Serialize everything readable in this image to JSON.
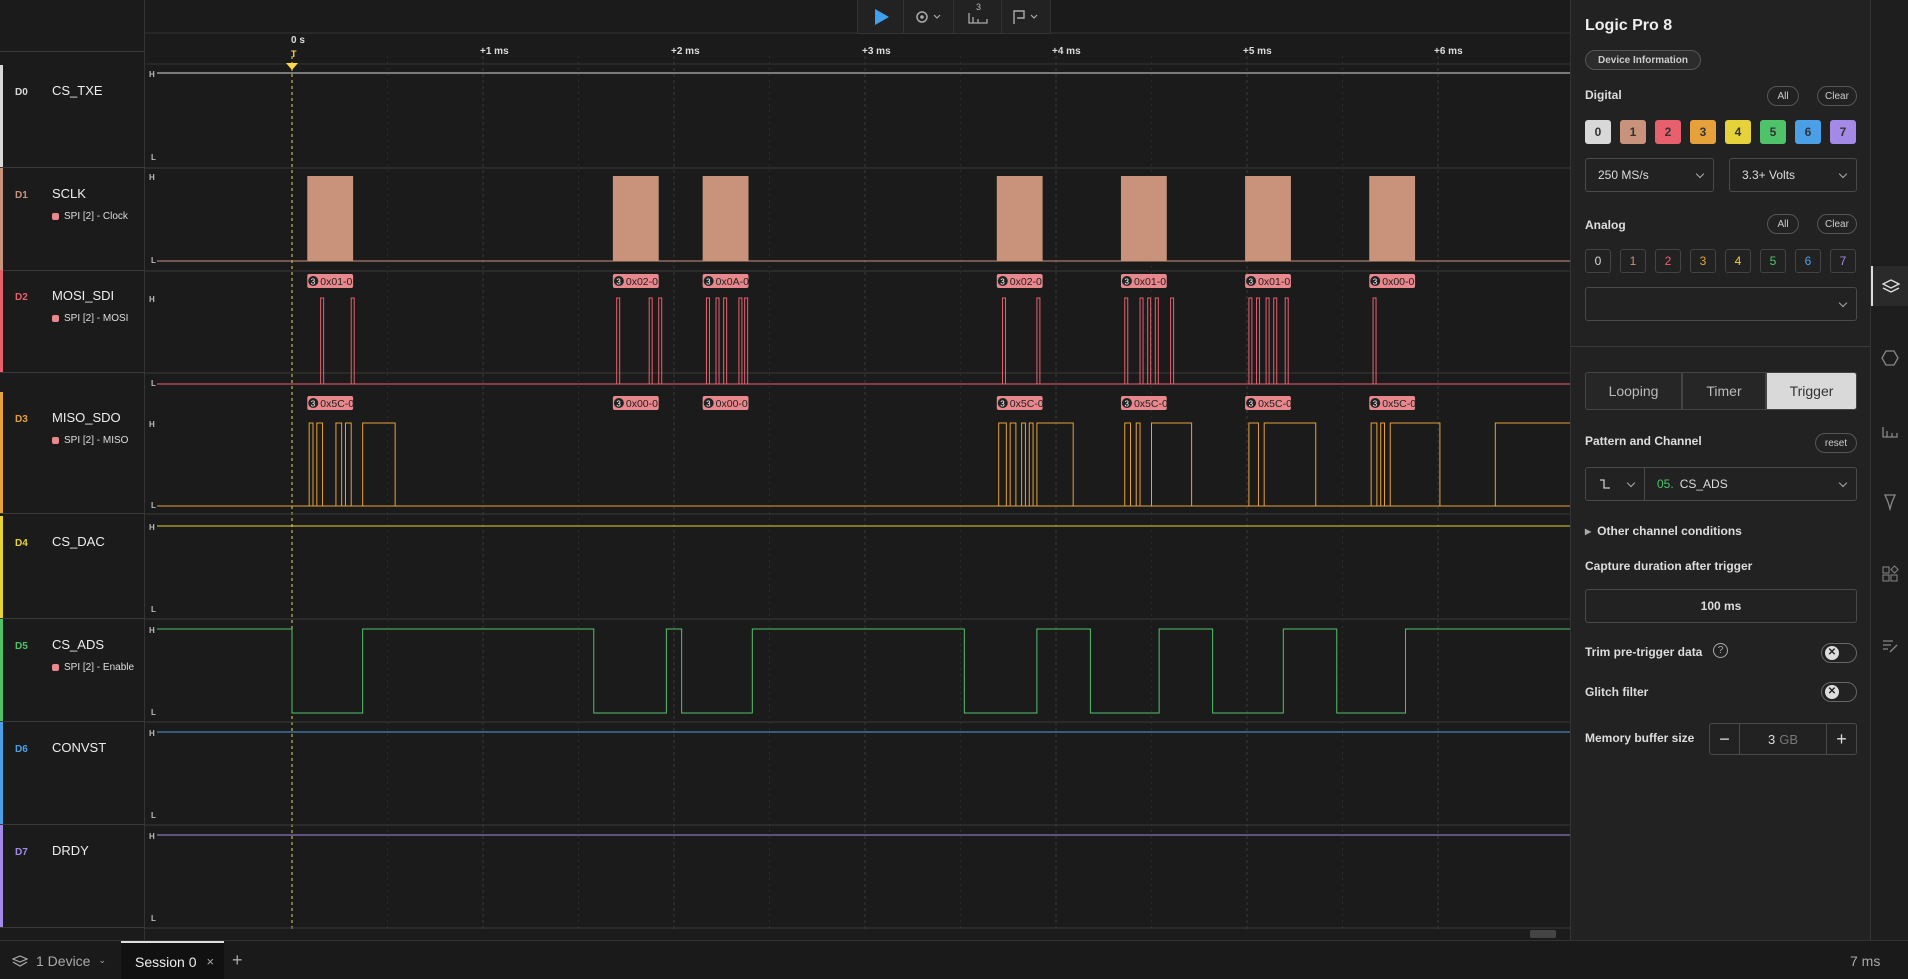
{
  "toolbar": {
    "capture_count": "3"
  },
  "timeline": {
    "origin_label": "0 s",
    "trigger_marker": "T",
    "ticks": [
      "+1 ms",
      "+2 ms",
      "+3 ms",
      "+4 ms",
      "+5 ms",
      "+6 ms"
    ],
    "level_high": "H",
    "level_low": "L"
  },
  "channels": [
    {
      "num": "D0",
      "name": "CS_TXE",
      "color": "#d8d8d8",
      "annotation": ""
    },
    {
      "num": "D1",
      "name": "SCLK",
      "color": "#c8937a",
      "annotation": "SPI [2] - Clock"
    },
    {
      "num": "D2",
      "name": "MOSI_SDI",
      "color": "#e8606e",
      "annotation": "SPI [2] - MOSI"
    },
    {
      "num": "D3",
      "name": "MISO_SDO",
      "color": "#e6a13a",
      "annotation": "SPI [2] - MISO"
    },
    {
      "num": "D4",
      "name": "CS_DAC",
      "color": "#e6d23a",
      "annotation": ""
    },
    {
      "num": "D5",
      "name": "CS_ADS",
      "color": "#4fc36a",
      "annotation": "SPI [2] - Enable"
    },
    {
      "num": "D6",
      "name": "CONVST",
      "color": "#4a9fe6",
      "annotation": ""
    },
    {
      "num": "D7",
      "name": "DRDY",
      "color": "#a38ae6",
      "annotation": ""
    }
  ],
  "decoded": {
    "mosi": [
      "0x01-0",
      "0x02-0",
      "0x0A-0",
      "0x02-0",
      "0x01-0",
      "0x01-0",
      "0x00-0"
    ],
    "miso": [
      "0x5C-0",
      "0x00-0",
      "0x00-0",
      "0x5C-0",
      "0x5C-0",
      "0x5C-0",
      "0x5C-0"
    ],
    "frame_index": "3"
  },
  "panel": {
    "device_title": "Logic Pro 8",
    "device_info_button": "Device Information",
    "digital_label": "Digital",
    "analog_label": "Analog",
    "all_label": "All",
    "clear_label": "Clear",
    "channel_numbers": [
      "0",
      "1",
      "2",
      "3",
      "4",
      "5",
      "6",
      "7"
    ],
    "sample_rate": "250 MS/s",
    "voltage": "3.3+ Volts",
    "analog_rate": "",
    "modes": [
      "Looping",
      "Timer",
      "Trigger"
    ],
    "active_mode": "Trigger",
    "pattern_label": "Pattern and Channel",
    "reset_label": "reset",
    "trigger_channel_num": "05.",
    "trigger_channel": "CS_ADS",
    "other_conditions": "Other channel conditions",
    "capture_duration_label": "Capture duration after trigger",
    "capture_duration": "100 ms",
    "trim_label": "Trim pre-trigger data",
    "glitch_label": "Glitch filter",
    "memory_label": "Memory buffer size",
    "memory_value": "3",
    "memory_unit": "GB",
    "minus": "−",
    "plus": "+"
  },
  "bottom": {
    "devices": "1 Device",
    "session": "Session 0",
    "close": "×",
    "add": "+",
    "zoom": "7 ms"
  },
  "colors": {
    "sclk_fill": "#c8937a",
    "badge": "#e8878c"
  },
  "icons": [
    "play-icon",
    "gear-icon",
    "capture-count-icon",
    "marker-flag-icon",
    "device-icon",
    "analyzers-icon",
    "measure-icon",
    "annotation-icon",
    "extensions-icon",
    "notes-icon"
  ]
}
